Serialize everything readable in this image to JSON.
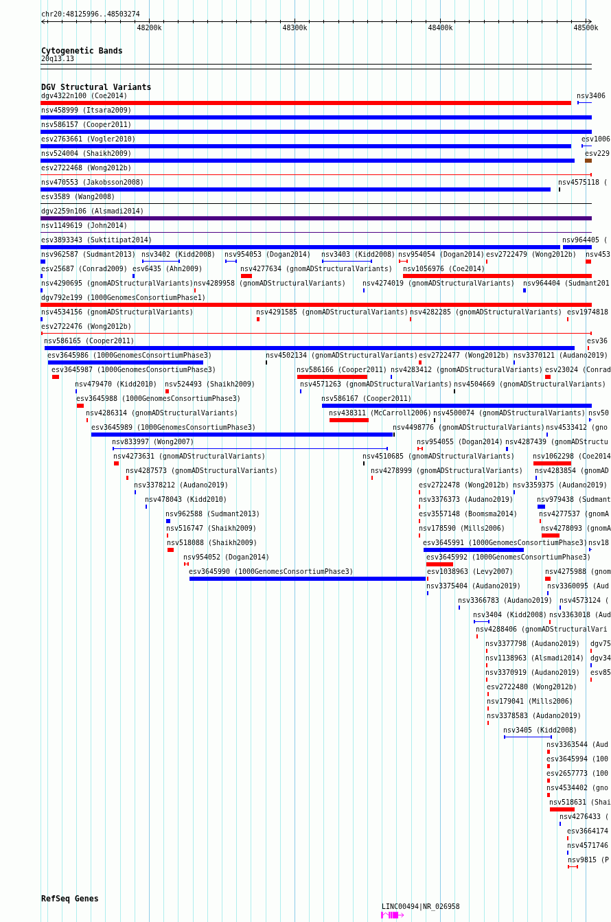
{
  "ruler": {
    "location": "chr20:48125996..48503274",
    "ticks": [
      "48200k",
      "48300k",
      "48400k",
      "48500k"
    ]
  },
  "cytogenetic_bands": {
    "title": "Cytogenetic Bands",
    "band": {
      "label": "20q13.13"
    }
  },
  "dgv": {
    "title": "DGV Structural Variants",
    "rows": [
      {
        "features": [
          {
            "label": "dgv4322n100 (Coe2014)",
            "color": "#ff0000",
            "kind": "bar"
          },
          {
            "label": "nsv3406",
            "color": "#0000ff",
            "kind": "span"
          }
        ]
      },
      {
        "features": [
          {
            "label": "nsv458999 (Itsara2009)",
            "color": "#0000ff",
            "kind": "bar"
          }
        ]
      },
      {
        "features": [
          {
            "label": "nsv586157 (Cooper2011)",
            "color": "#0000ff",
            "kind": "bar"
          }
        ]
      },
      {
        "features": [
          {
            "label": "esv2763661 (Vogler2010)",
            "color": "#0000ff",
            "kind": "bar"
          },
          {
            "label": "esv1006",
            "color": "#0000ff",
            "kind": "span"
          }
        ]
      },
      {
        "features": [
          {
            "label": "nsv524004 (Shaikh2009)",
            "color": "#0000ff",
            "kind": "bar"
          },
          {
            "label": "esv229",
            "color": "#8b4513",
            "kind": "bar"
          }
        ]
      },
      {
        "features": [
          {
            "label": "esv2722468 (Wong2012b)",
            "color": "#ff0000",
            "kind": "span"
          }
        ]
      },
      {
        "features": [
          {
            "label": "nsv470553 (Jakobsson2008)",
            "color": "#0000ff",
            "kind": "bar"
          },
          {
            "label": "nsv4575118 (",
            "color": "#000000",
            "kind": "bar"
          }
        ]
      },
      {
        "features": [
          {
            "label": "esv3589 (Wang2008)",
            "color": "#000000",
            "kind": "span"
          }
        ]
      },
      {
        "features": [
          {
            "label": "dgv2259n106 (Alsmadi2014)",
            "color": "#4b0082",
            "kind": "bar"
          }
        ]
      },
      {
        "features": [
          {
            "label": "nsv1149619 (John2014)",
            "color": "#4b0082",
            "kind": "span"
          }
        ]
      },
      {
        "features": [
          {
            "label": "esv3893343 (Suktitipat2014)",
            "color": "#0000ff",
            "kind": "bar"
          },
          {
            "label": "nsv964405 (",
            "color": "#0000ff",
            "kind": "bar"
          }
        ]
      },
      {
        "features": [
          {
            "label": "nsv962587 (Sudmant2013)",
            "color": "#0000ff",
            "kind": "bar"
          },
          {
            "label": "nsv3402 (Kidd2008)",
            "color": "#0000ff",
            "kind": "span"
          },
          {
            "label": "nsv954053 (Dogan2014)",
            "color": "#0000ff",
            "kind": "span"
          },
          {
            "label": "nsv3403 (Kidd2008)",
            "color": "#0000ff",
            "kind": "span"
          },
          {
            "label": "nsv954054 (Dogan2014)",
            "color": "#ff0000",
            "kind": "span"
          },
          {
            "label": "esv2722479 (Wong2012b)",
            "color": "#ff0000",
            "kind": "bar"
          },
          {
            "label": "nsv453",
            "color": "#ff0000",
            "kind": "bar"
          }
        ]
      },
      {
        "features": [
          {
            "label": "esv25687 (Conrad2009)",
            "color": "#0000ff",
            "kind": "bar"
          },
          {
            "label": "esv6435 (Ahn2009)",
            "color": "#0000ff",
            "kind": "bar"
          },
          {
            "label": "nsv4277634 (gnomADStructuralVariants)",
            "color": "#ff0000",
            "kind": "bar"
          },
          {
            "label": "nsv1056976 (Coe2014)",
            "color": "#ff0000",
            "kind": "bar"
          }
        ]
      },
      {
        "features": [
          {
            "label": "nsv4290695 (gnomADStructuralVariants)",
            "color": "#0000ff",
            "kind": "bar"
          },
          {
            "label": "nsv4289958 (gnomADStructuralVariants)",
            "color": "#ff0000",
            "kind": "bar"
          },
          {
            "label": "nsv4274019 (gnomADStructuralVariants)",
            "color": "#0000ff",
            "kind": "bar"
          },
          {
            "label": "nsv964404 (Sudmant201",
            "color": "#0000ff",
            "kind": "bar"
          }
        ]
      },
      {
        "features": [
          {
            "label": "dgv792e199 (1000GenomesConsortiumPhase1)",
            "color": "#ff0000",
            "kind": "bar"
          }
        ]
      },
      {
        "features": [
          {
            "label": "nsv4534156 (gnomADStructuralVariants)",
            "color": "#0000ff",
            "kind": "bar"
          },
          {
            "label": "nsv4291585 (gnomADStructuralVariants)",
            "color": "#ff0000",
            "kind": "bar"
          },
          {
            "label": "nsv4282285 (gnomADStructuralVariants)",
            "color": "#ff0000",
            "kind": "bar"
          },
          {
            "label": "esv1974818",
            "color": "#ff0000",
            "kind": "bar"
          }
        ]
      },
      {
        "features": [
          {
            "label": "esv2722476 (Wong2012b)",
            "color": "#ff0000",
            "kind": "span"
          }
        ]
      },
      {
        "features": [
          {
            "label": "nsv586165 (Cooper2011)",
            "color": "#0000ff",
            "kind": "bar"
          },
          {
            "label": "esv36",
            "color": "#ff0000",
            "kind": "bar"
          }
        ]
      },
      {
        "features": [
          {
            "label": "esv3645986 (1000GenomesConsortiumPhase3)",
            "color": "#0000ff",
            "kind": "bar"
          },
          {
            "label": "nsv4502134 (gnomADStructuralVariants)",
            "color": "#000000",
            "kind": "bar"
          },
          {
            "label": "esv2722477 (Wong2012b)",
            "color": "#ff0000",
            "kind": "bar"
          },
          {
            "label": "nsv3370121 (Audano2019)",
            "color": "#0000ff",
            "kind": "bar"
          }
        ]
      },
      {
        "features": [
          {
            "label": "esv3645987 (1000GenomesConsortiumPhase3)",
            "color": "#ff0000",
            "kind": "bar"
          },
          {
            "label": "nsv586166 (Cooper2011)",
            "color": "#ff0000",
            "kind": "bar"
          },
          {
            "label": "nsv4283412 (gnomADStructuralVariants)",
            "color": "#0000ff",
            "kind": "bar"
          },
          {
            "label": "esv23024 (Conrad",
            "color": "#ff0000",
            "kind": "bar"
          }
        ]
      },
      {
        "features": [
          {
            "label": "nsv479470 (Kidd2010)",
            "color": "#0000ff",
            "kind": "bar"
          },
          {
            "label": "nsv524493 (Shaikh2009)",
            "color": "#ff0000",
            "kind": "bar"
          },
          {
            "label": "nsv4571263 (gnomADStructuralVariants)",
            "color": "#0000ff",
            "kind": "bar"
          },
          {
            "label": "nsv4504669 (gnomADStructuralVariants)",
            "color": "#000000",
            "kind": "bar"
          }
        ]
      },
      {
        "features": [
          {
            "label": "esv3645988 (1000GenomesConsortiumPhase3)",
            "color": "#ff0000",
            "kind": "bar"
          },
          {
            "label": "nsv586167 (Cooper2011)",
            "color": "#0000ff",
            "kind": "bar"
          }
        ]
      },
      {
        "features": [
          {
            "label": "nsv4286314 (gnomADStructuralVariants)",
            "color": "#ff0000",
            "kind": "bar"
          },
          {
            "label": "nsv438311 (McCarroll2006)",
            "color": "#ff0000",
            "kind": "bar"
          },
          {
            "label": "nsv4500074 (gnomADStructuralVariants)",
            "color": "#000000",
            "kind": "bar"
          },
          {
            "label": "nsv50",
            "color": "#0000ff",
            "kind": "span"
          }
        ]
      },
      {
        "features": [
          {
            "label": "esv3645989 (1000GenomesConsortiumPhase3)",
            "color": "#0000ff",
            "kind": "bar"
          },
          {
            "label": "nsv4498776 (gnomADStructuralVariants)",
            "color": "#000000",
            "kind": "bar"
          },
          {
            "label": "nsv4533412 (gno",
            "color": "#0000ff",
            "kind": "bar"
          }
        ]
      },
      {
        "features": [
          {
            "label": "nsv833997 (Wong2007)",
            "color": "#0000ff",
            "kind": "span"
          },
          {
            "label": "nsv954055 (Dogan2014)",
            "color": "#ff0000",
            "kind": "span"
          },
          {
            "label": "nsv4287439 (gnomADStructu",
            "color": "#0000ff",
            "kind": "bar"
          }
        ]
      },
      {
        "features": [
          {
            "label": "nsv4273631 (gnomADStructuralVariants)",
            "color": "#ff0000",
            "kind": "bar"
          },
          {
            "label": "nsv4510685 (gnomADStructuralVariants)",
            "color": "#000000",
            "kind": "bar"
          },
          {
            "label": "nsv1062298 (Coe2014",
            "color": "#ff0000",
            "kind": "bar"
          }
        ]
      },
      {
        "features": [
          {
            "label": "nsv4287573 (gnomADStructuralVariants)",
            "color": "#ff0000",
            "kind": "bar"
          },
          {
            "label": "nsv4278999 (gnomADStructuralVariants)",
            "color": "#ff0000",
            "kind": "bar"
          },
          {
            "label": "nsv4283854 (gnomAD",
            "color": "#0000ff",
            "kind": "bar"
          }
        ]
      },
      {
        "features": [
          {
            "label": "nsv3378212 (Audano2019)",
            "color": "#0000ff",
            "kind": "bar"
          },
          {
            "label": "esv2722478 (Wong2012b)",
            "color": "#ff0000",
            "kind": "bar"
          },
          {
            "label": "nsv3359375 (Audano2019)",
            "color": "#0000ff",
            "kind": "bar"
          }
        ]
      },
      {
        "features": [
          {
            "label": "nsv478043 (Kidd2010)",
            "color": "#0000ff",
            "kind": "bar"
          },
          {
            "label": "nsv3376373 (Audano2019)",
            "color": "#ff0000",
            "kind": "bar"
          },
          {
            "label": "nsv979438 (Sudmant",
            "color": "#0000ff",
            "kind": "bar"
          }
        ]
      },
      {
        "features": [
          {
            "label": "nsv962588 (Sudmant2013)",
            "color": "#0000ff",
            "kind": "bar"
          },
          {
            "label": "esv3557148 (Boomsma2014)",
            "color": "#ff0000",
            "kind": "bar"
          },
          {
            "label": "nsv4277537 (gnomA",
            "color": "#ff0000",
            "kind": "bar"
          }
        ]
      },
      {
        "features": [
          {
            "label": "nsv516747 (Shaikh2009)",
            "color": "#ff0000",
            "kind": "bar"
          },
          {
            "label": "nsv178590 (Mills2006)",
            "color": "#ff0000",
            "kind": "bar"
          },
          {
            "label": "nsv4278093 (gnomA",
            "color": "#ff0000",
            "kind": "bar"
          }
        ]
      },
      {
        "features": [
          {
            "label": "nsv518088 (Shaikh2009)",
            "color": "#ff0000",
            "kind": "bar"
          },
          {
            "label": "esv3645991 (1000GenomesConsortiumPhase3)",
            "color": "#0000ff",
            "kind": "bar"
          },
          {
            "label": "nsv18",
            "color": "#0000ff",
            "kind": "span"
          }
        ]
      },
      {
        "features": [
          {
            "label": "nsv954052 (Dogan2014)",
            "color": "#ff0000",
            "kind": "span"
          },
          {
            "label": "esv3645992 (1000GenomesConsortiumPhase3)",
            "color": "#ff0000",
            "kind": "bar"
          }
        ]
      },
      {
        "features": [
          {
            "label": "esv3645990 (1000GenomesConsortiumPhase3)",
            "color": "#0000ff",
            "kind": "bar"
          },
          {
            "label": "esv1038963 (Levy2007)",
            "color": "#ff0000",
            "kind": "bar"
          },
          {
            "label": "nsv4275988 (gnom",
            "color": "#ff0000",
            "kind": "bar"
          }
        ]
      },
      {
        "features": [
          {
            "label": "nsv3375404 (Audano2019)",
            "color": "#0000ff",
            "kind": "bar"
          },
          {
            "label": "nsv3360095 (Aud",
            "color": "#0000ff",
            "kind": "bar"
          }
        ]
      },
      {
        "features": [
          {
            "label": "nsv3366783 (Audano2019)",
            "color": "#0000ff",
            "kind": "bar"
          },
          {
            "label": "nsv4573124 (",
            "color": "#0000ff",
            "kind": "bar"
          }
        ]
      },
      {
        "features": [
          {
            "label": "nsv3404 (Kidd2008)",
            "color": "#0000ff",
            "kind": "span"
          },
          {
            "label": "nsv3363018 (Aud",
            "color": "#ff0000",
            "kind": "bar"
          }
        ]
      },
      {
        "features": [
          {
            "label": "nsv4288406 (gnomADStructuralVari",
            "color": "#ff0000",
            "kind": "bar"
          }
        ]
      },
      {
        "features": [
          {
            "label": "nsv3377798 (Audano2019)",
            "color": "#ff0000",
            "kind": "bar"
          },
          {
            "label": "dgv75",
            "color": "#ff0000",
            "kind": "bar"
          }
        ]
      },
      {
        "features": [
          {
            "label": "nsv1138963 (Alsmadi2014)",
            "color": "#ff0000",
            "kind": "bar"
          },
          {
            "label": "dgv34",
            "color": "#0000ff",
            "kind": "bar"
          }
        ]
      },
      {
        "features": [
          {
            "label": "nsv3370919 (Audano2019)",
            "color": "#ff0000",
            "kind": "bar"
          },
          {
            "label": "esv85",
            "color": "#ff0000",
            "kind": "bar"
          }
        ]
      },
      {
        "features": [
          {
            "label": "esv2722480 (Wong2012b)",
            "color": "#ff0000",
            "kind": "bar"
          }
        ]
      },
      {
        "features": [
          {
            "label": "nsv179041 (Mills2006)",
            "color": "#ff0000",
            "kind": "bar"
          }
        ]
      },
      {
        "features": [
          {
            "label": "nsv3378583 (Audano2019)",
            "color": "#ff0000",
            "kind": "bar"
          }
        ]
      },
      {
        "features": [
          {
            "label": "nsv3405 (Kidd2008)",
            "color": "#0000ff",
            "kind": "span"
          }
        ]
      },
      {
        "features": [
          {
            "label": "nsv3363544 (Aud",
            "color": "#ff0000",
            "kind": "bar"
          }
        ]
      },
      {
        "features": [
          {
            "label": "esv3645994 (100",
            "color": "#ff0000",
            "kind": "bar"
          }
        ]
      },
      {
        "features": [
          {
            "label": "esv2657773 (100",
            "color": "#ff0000",
            "kind": "bar"
          }
        ]
      },
      {
        "features": [
          {
            "label": "nsv4534402 (gno",
            "color": "#ff0000",
            "kind": "bar"
          }
        ]
      },
      {
        "features": [
          {
            "label": "nsv518631 (Shai",
            "color": "#ff0000",
            "kind": "bar"
          }
        ]
      },
      {
        "features": [
          {
            "label": "nsv4276433 (",
            "color": "#0000ff",
            "kind": "bar"
          }
        ]
      },
      {
        "features": [
          {
            "label": "esv3664174",
            "color": "#ff0000",
            "kind": "bar"
          }
        ]
      },
      {
        "features": [
          {
            "label": "nsv4571746",
            "color": "#0000ff",
            "kind": "bar"
          }
        ]
      },
      {
        "features": [
          {
            "label": "nsv9815 (P",
            "color": "#ff0000",
            "kind": "span"
          }
        ]
      }
    ]
  },
  "refseq_genes": {
    "title": "RefSeq Genes",
    "genes": [
      {
        "label": "LINC00494|NR_026958"
      }
    ]
  }
}
